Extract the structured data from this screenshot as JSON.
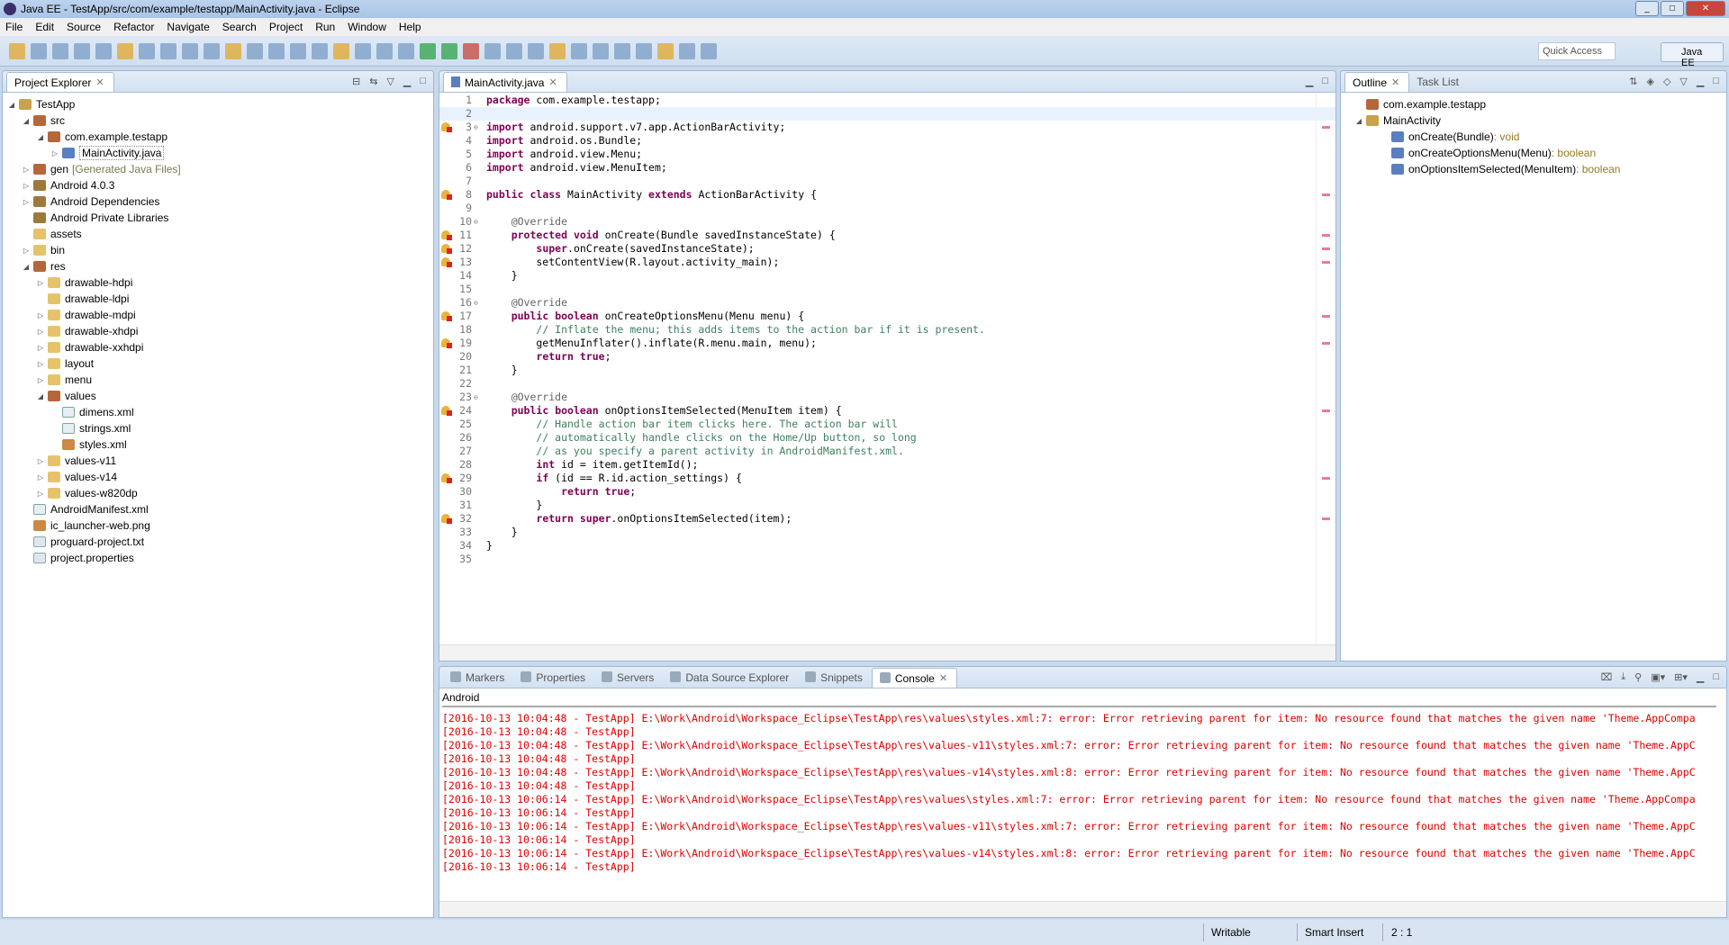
{
  "window": {
    "title": "Java EE - TestApp/src/com/example/testapp/MainActivity.java - Eclipse"
  },
  "menu": [
    "File",
    "Edit",
    "Source",
    "Refactor",
    "Navigate",
    "Search",
    "Project",
    "Run",
    "Window",
    "Help"
  ],
  "toolbar": {
    "quick_access_placeholder": "Quick Access",
    "perspective": "Java EE"
  },
  "project_explorer": {
    "tab": "Project Explorer",
    "items": [
      {
        "label": "TestApp",
        "depth": 0,
        "arrow": "open",
        "icon": "proj"
      },
      {
        "label": "src",
        "depth": 1,
        "arrow": "open",
        "icon": "pkg"
      },
      {
        "label": "com.example.testapp",
        "depth": 2,
        "arrow": "open",
        "icon": "pkg"
      },
      {
        "label": "MainActivity.java",
        "depth": 3,
        "arrow": "closed",
        "icon": "java",
        "selected": true
      },
      {
        "label": "gen",
        "suffix": "[Generated Java Files]",
        "depth": 1,
        "arrow": "closed",
        "icon": "pkg"
      },
      {
        "label": "Android 4.0.3",
        "depth": 1,
        "arrow": "closed",
        "icon": "lib"
      },
      {
        "label": "Android Dependencies",
        "depth": 1,
        "arrow": "closed",
        "icon": "lib"
      },
      {
        "label": "Android Private Libraries",
        "depth": 1,
        "arrow": "",
        "icon": "lib"
      },
      {
        "label": "assets",
        "depth": 1,
        "arrow": "",
        "icon": "folder"
      },
      {
        "label": "bin",
        "depth": 1,
        "arrow": "closed",
        "icon": "folder"
      },
      {
        "label": "res",
        "depth": 1,
        "arrow": "open",
        "icon": "pkg"
      },
      {
        "label": "drawable-hdpi",
        "depth": 2,
        "arrow": "closed",
        "icon": "folder"
      },
      {
        "label": "drawable-ldpi",
        "depth": 2,
        "arrow": "",
        "icon": "folder"
      },
      {
        "label": "drawable-mdpi",
        "depth": 2,
        "arrow": "closed",
        "icon": "folder"
      },
      {
        "label": "drawable-xhdpi",
        "depth": 2,
        "arrow": "closed",
        "icon": "folder"
      },
      {
        "label": "drawable-xxhdpi",
        "depth": 2,
        "arrow": "closed",
        "icon": "folder"
      },
      {
        "label": "layout",
        "depth": 2,
        "arrow": "closed",
        "icon": "folder"
      },
      {
        "label": "menu",
        "depth": 2,
        "arrow": "closed",
        "icon": "folder"
      },
      {
        "label": "values",
        "depth": 2,
        "arrow": "open",
        "icon": "pkg"
      },
      {
        "label": "dimens.xml",
        "depth": 3,
        "arrow": "",
        "icon": "xml"
      },
      {
        "label": "strings.xml",
        "depth": 3,
        "arrow": "",
        "icon": "xml"
      },
      {
        "label": "styles.xml",
        "depth": 3,
        "arrow": "",
        "icon": "img"
      },
      {
        "label": "values-v11",
        "depth": 2,
        "arrow": "closed",
        "icon": "folder"
      },
      {
        "label": "values-v14",
        "depth": 2,
        "arrow": "closed",
        "icon": "folder"
      },
      {
        "label": "values-w820dp",
        "depth": 2,
        "arrow": "closed",
        "icon": "folder"
      },
      {
        "label": "AndroidManifest.xml",
        "depth": 1,
        "arrow": "",
        "icon": "xml"
      },
      {
        "label": "ic_launcher-web.png",
        "depth": 1,
        "arrow": "",
        "icon": "img"
      },
      {
        "label": "proguard-project.txt",
        "depth": 1,
        "arrow": "",
        "icon": "file"
      },
      {
        "label": "project.properties",
        "depth": 1,
        "arrow": "",
        "icon": "file"
      }
    ]
  },
  "editor": {
    "tab": "MainActivity.java",
    "error_lines": [
      3,
      8,
      11,
      12,
      13,
      17,
      19,
      24,
      29,
      32
    ],
    "fold_lines": [
      3,
      10,
      16,
      23
    ],
    "current_line": 2,
    "lines": [
      "package com.example.testapp;",
      "",
      "import android.support.v7.app.ActionBarActivity;",
      "import android.os.Bundle;",
      "import android.view.Menu;",
      "import android.view.MenuItem;",
      "",
      "public class MainActivity extends ActionBarActivity {",
      "",
      "    @Override",
      "    protected void onCreate(Bundle savedInstanceState) {",
      "        super.onCreate(savedInstanceState);",
      "        setContentView(R.layout.activity_main);",
      "    }",
      "",
      "    @Override",
      "    public boolean onCreateOptionsMenu(Menu menu) {",
      "        // Inflate the menu; this adds items to the action bar if it is present.",
      "        getMenuInflater().inflate(R.menu.main, menu);",
      "        return true;",
      "    }",
      "",
      "    @Override",
      "    public boolean onOptionsItemSelected(MenuItem item) {",
      "        // Handle action bar item clicks here. The action bar will",
      "        // automatically handle clicks on the Home/Up button, so long",
      "        // as you specify a parent activity in AndroidManifest.xml.",
      "        int id = item.getItemId();",
      "        if (id == R.id.action_settings) {",
      "            return true;",
      "        }",
      "        return super.onOptionsItemSelected(item);",
      "    }",
      "}",
      ""
    ]
  },
  "outline": {
    "tabs": [
      "Outline",
      "Task List"
    ],
    "items": [
      {
        "label": "com.example.testapp",
        "type": "",
        "depth": 0
      },
      {
        "label": "MainActivity",
        "type": "",
        "depth": 0,
        "arrow": "open"
      },
      {
        "label": "onCreate(Bundle)",
        "type": " : void",
        "depth": 1
      },
      {
        "label": "onCreateOptionsMenu(Menu)",
        "type": " : boolean",
        "depth": 1
      },
      {
        "label": "onOptionsItemSelected(MenuItem)",
        "type": " : boolean",
        "depth": 1
      }
    ]
  },
  "bottom": {
    "tabs": [
      "Markers",
      "Properties",
      "Servers",
      "Data Source Explorer",
      "Snippets",
      "Console"
    ],
    "active": "Console",
    "console_name": "Android",
    "lines": [
      "[2016-10-13 10:04:48 - TestApp] E:\\Work\\Android\\Workspace_Eclipse\\TestApp\\res\\values\\styles.xml:7: error: Error retrieving parent for item: No resource found that matches the given name 'Theme.AppCompa",
      "[2016-10-13 10:04:48 - TestApp]",
      "[2016-10-13 10:04:48 - TestApp] E:\\Work\\Android\\Workspace_Eclipse\\TestApp\\res\\values-v11\\styles.xml:7: error: Error retrieving parent for item: No resource found that matches the given name 'Theme.AppC",
      "[2016-10-13 10:04:48 - TestApp]",
      "[2016-10-13 10:04:48 - TestApp] E:\\Work\\Android\\Workspace_Eclipse\\TestApp\\res\\values-v14\\styles.xml:8: error: Error retrieving parent for item: No resource found that matches the given name 'Theme.AppC",
      "[2016-10-13 10:04:48 - TestApp]",
      "[2016-10-13 10:06:14 - TestApp] E:\\Work\\Android\\Workspace_Eclipse\\TestApp\\res\\values\\styles.xml:7: error: Error retrieving parent for item: No resource found that matches the given name 'Theme.AppCompa",
      "[2016-10-13 10:06:14 - TestApp]",
      "[2016-10-13 10:06:14 - TestApp] E:\\Work\\Android\\Workspace_Eclipse\\TestApp\\res\\values-v11\\styles.xml:7: error: Error retrieving parent for item: No resource found that matches the given name 'Theme.AppC",
      "[2016-10-13 10:06:14 - TestApp]",
      "[2016-10-13 10:06:14 - TestApp] E:\\Work\\Android\\Workspace_Eclipse\\TestApp\\res\\values-v14\\styles.xml:8: error: Error retrieving parent for item: No resource found that matches the given name 'Theme.AppC",
      "[2016-10-13 10:06:14 - TestApp]"
    ]
  },
  "status": {
    "writable": "Writable",
    "insert_mode": "Smart Insert",
    "position": "2 : 1"
  },
  "colors": {
    "keyword": "#7f0055",
    "comment": "#3f7f5f",
    "console_error": "#e00000"
  }
}
